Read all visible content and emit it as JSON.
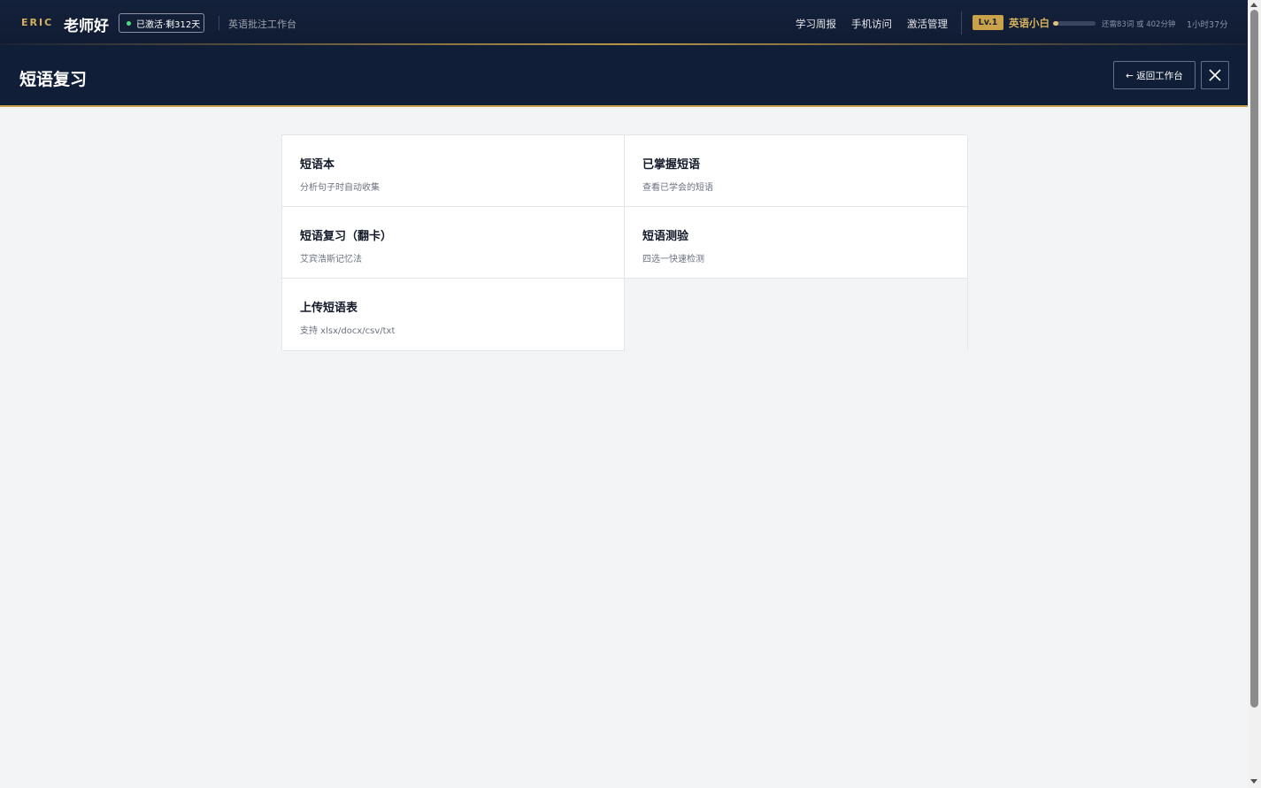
{
  "topbar": {
    "brand": "ERIC",
    "greeting": "老师好",
    "status": "已激活·剩312天",
    "workbench": "英语批注工作台",
    "nav": [
      "学习周报",
      "手机访问",
      "激活管理"
    ],
    "level_badge": "Lv.1",
    "rank_name": "英语小白",
    "xp_progress": 0.12,
    "xp_text": "还需83词 或 402分钟",
    "study_time": "1小时37分",
    "colors": {
      "accent_gold": "#c9a24a",
      "status_green": "#4ade80",
      "navy": "#101e37"
    }
  },
  "header": {
    "title": "短语复习",
    "back_label": "← 返回工作台",
    "close_icon": "close-icon"
  },
  "cards": [
    {
      "title": "短语本",
      "desc": "分析句子时自动收集"
    },
    {
      "title": "已掌握短语",
      "desc": "查看已学会的短语"
    },
    {
      "title": "短语复习（翻卡）",
      "desc": "艾宾浩斯记忆法"
    },
    {
      "title": "短语测验",
      "desc": "四选一快速检测"
    },
    {
      "title": "上传短语表",
      "desc": "支持 xlsx/docx/csv/txt"
    }
  ]
}
